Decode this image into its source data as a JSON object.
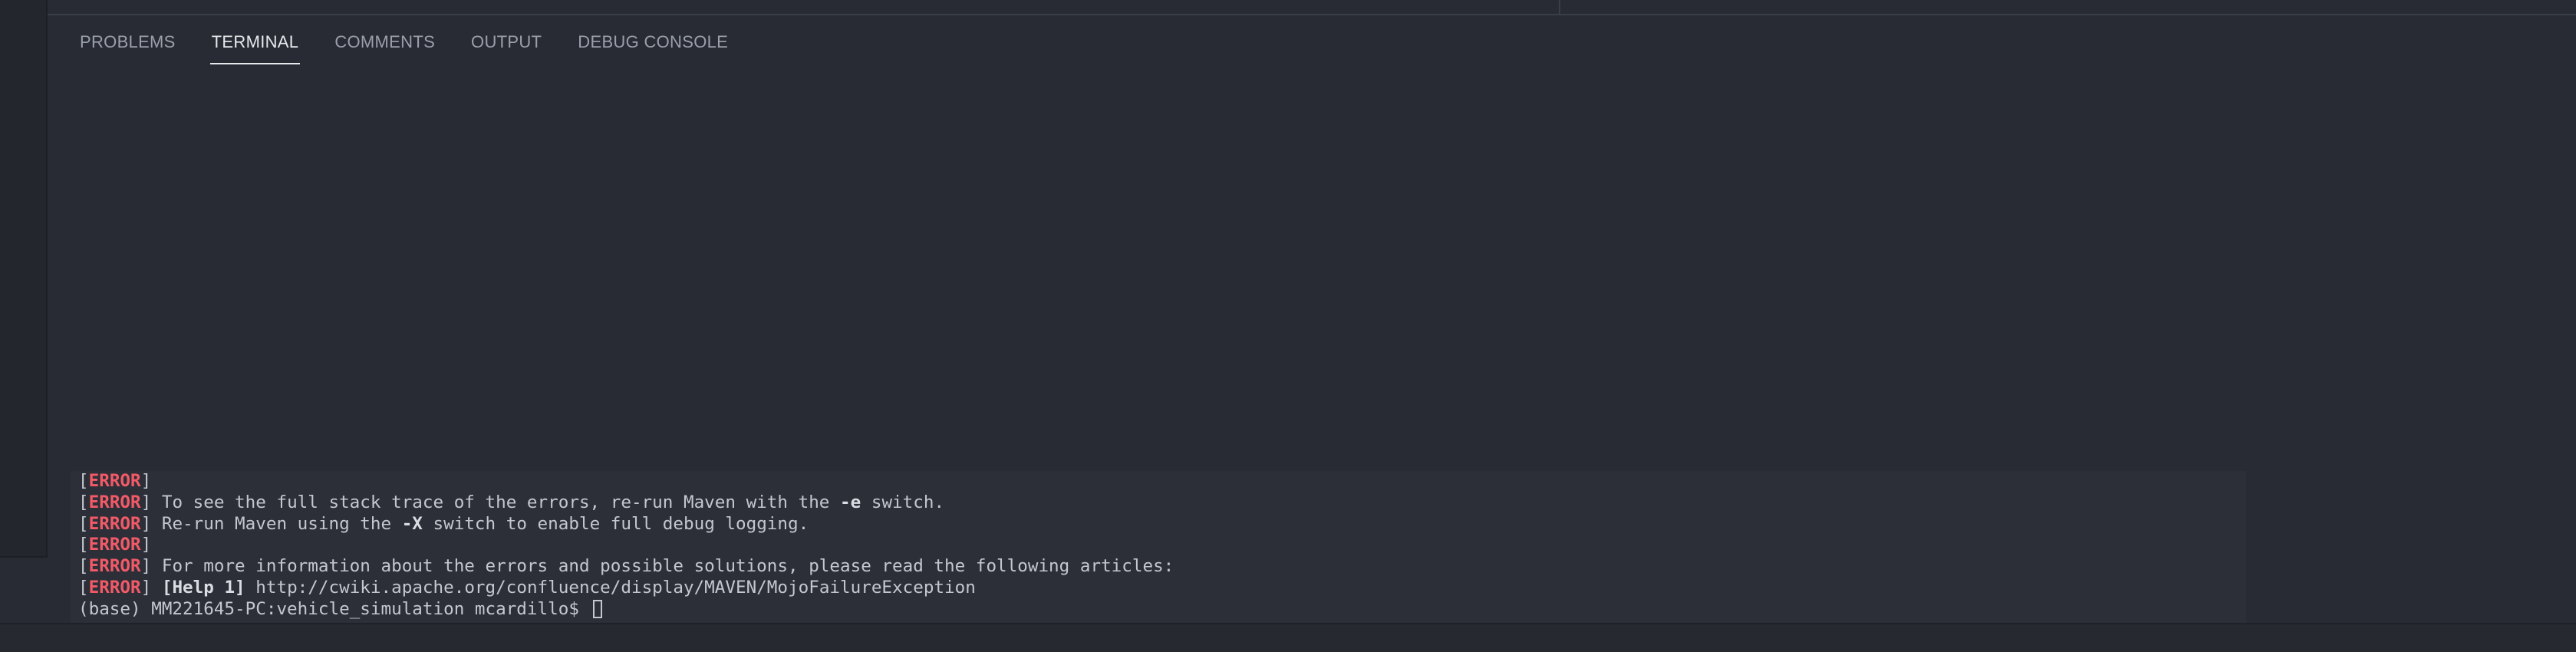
{
  "panel": {
    "tabs": [
      {
        "label": "PROBLEMS"
      },
      {
        "label": "TERMINAL"
      },
      {
        "label": "COMMENTS"
      },
      {
        "label": "OUTPUT"
      },
      {
        "label": "DEBUG CONSOLE"
      }
    ],
    "active_tab": "TERMINAL"
  },
  "terminal": {
    "error_tag": "ERROR",
    "lines": [
      {
        "text": ""
      },
      {
        "text": " To see the full stack trace of the errors, re-run Maven with the ",
        "bold": "-e",
        "after": " switch."
      },
      {
        "text": " Re-run Maven using the ",
        "bold": "-X",
        "after": " switch to enable full debug logging."
      },
      {
        "text": ""
      },
      {
        "text": " For more information about the errors and possible solutions, please read the following articles:"
      },
      {
        "text": " ",
        "bold": "[Help 1]",
        "after": " http://cwiki.apache.org/confluence/display/MAVEN/MojoFailureException"
      }
    ],
    "prompt": "(base) MM221645-PC:vehicle_simulation mcardillo$"
  },
  "colors": {
    "background": "#282b33",
    "terminal_bg": "#2c2f37",
    "error": "#f25a68",
    "text": "#c3c7cf"
  }
}
